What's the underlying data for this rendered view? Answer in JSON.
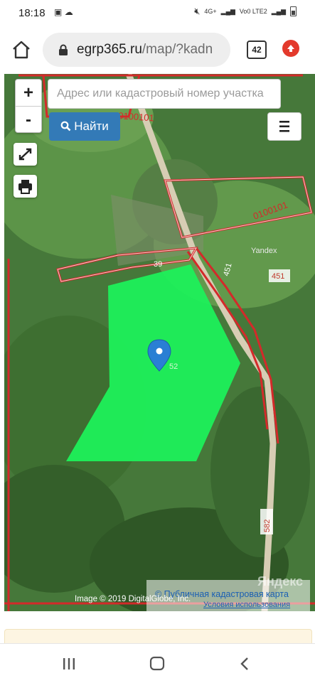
{
  "status_bar": {
    "time": "18:18",
    "left_icons": [
      "image-icon",
      "weather-icon"
    ],
    "signal_1": "4G+",
    "signal_2": "Vo0 LTE2"
  },
  "browser": {
    "url_domain": "egrp365.ru",
    "url_path": "/map/?kadn",
    "tab_count": "42"
  },
  "map": {
    "search_placeholder": "Адрес или кадастровый номер участка",
    "find_label": "Найти",
    "zoom_in_label": "+",
    "zoom_out_label": "-",
    "parcel_labels": [
      "0100101",
      "0100101",
      "39",
      "451",
      "451",
      "582"
    ],
    "provider_label": "Yandex",
    "attribution": "Image © 2019 DigitalGlobe, Inc.",
    "cadastral_link": "© Публичная кадастровая карта",
    "terms_link": "Условия использования",
    "yandex_watermark": "Яндекс",
    "colors": {
      "parcel_fill": "#1ef05a",
      "border": "#d32a2a",
      "marker": "#2a7fd4",
      "button": "#337ab7"
    }
  }
}
